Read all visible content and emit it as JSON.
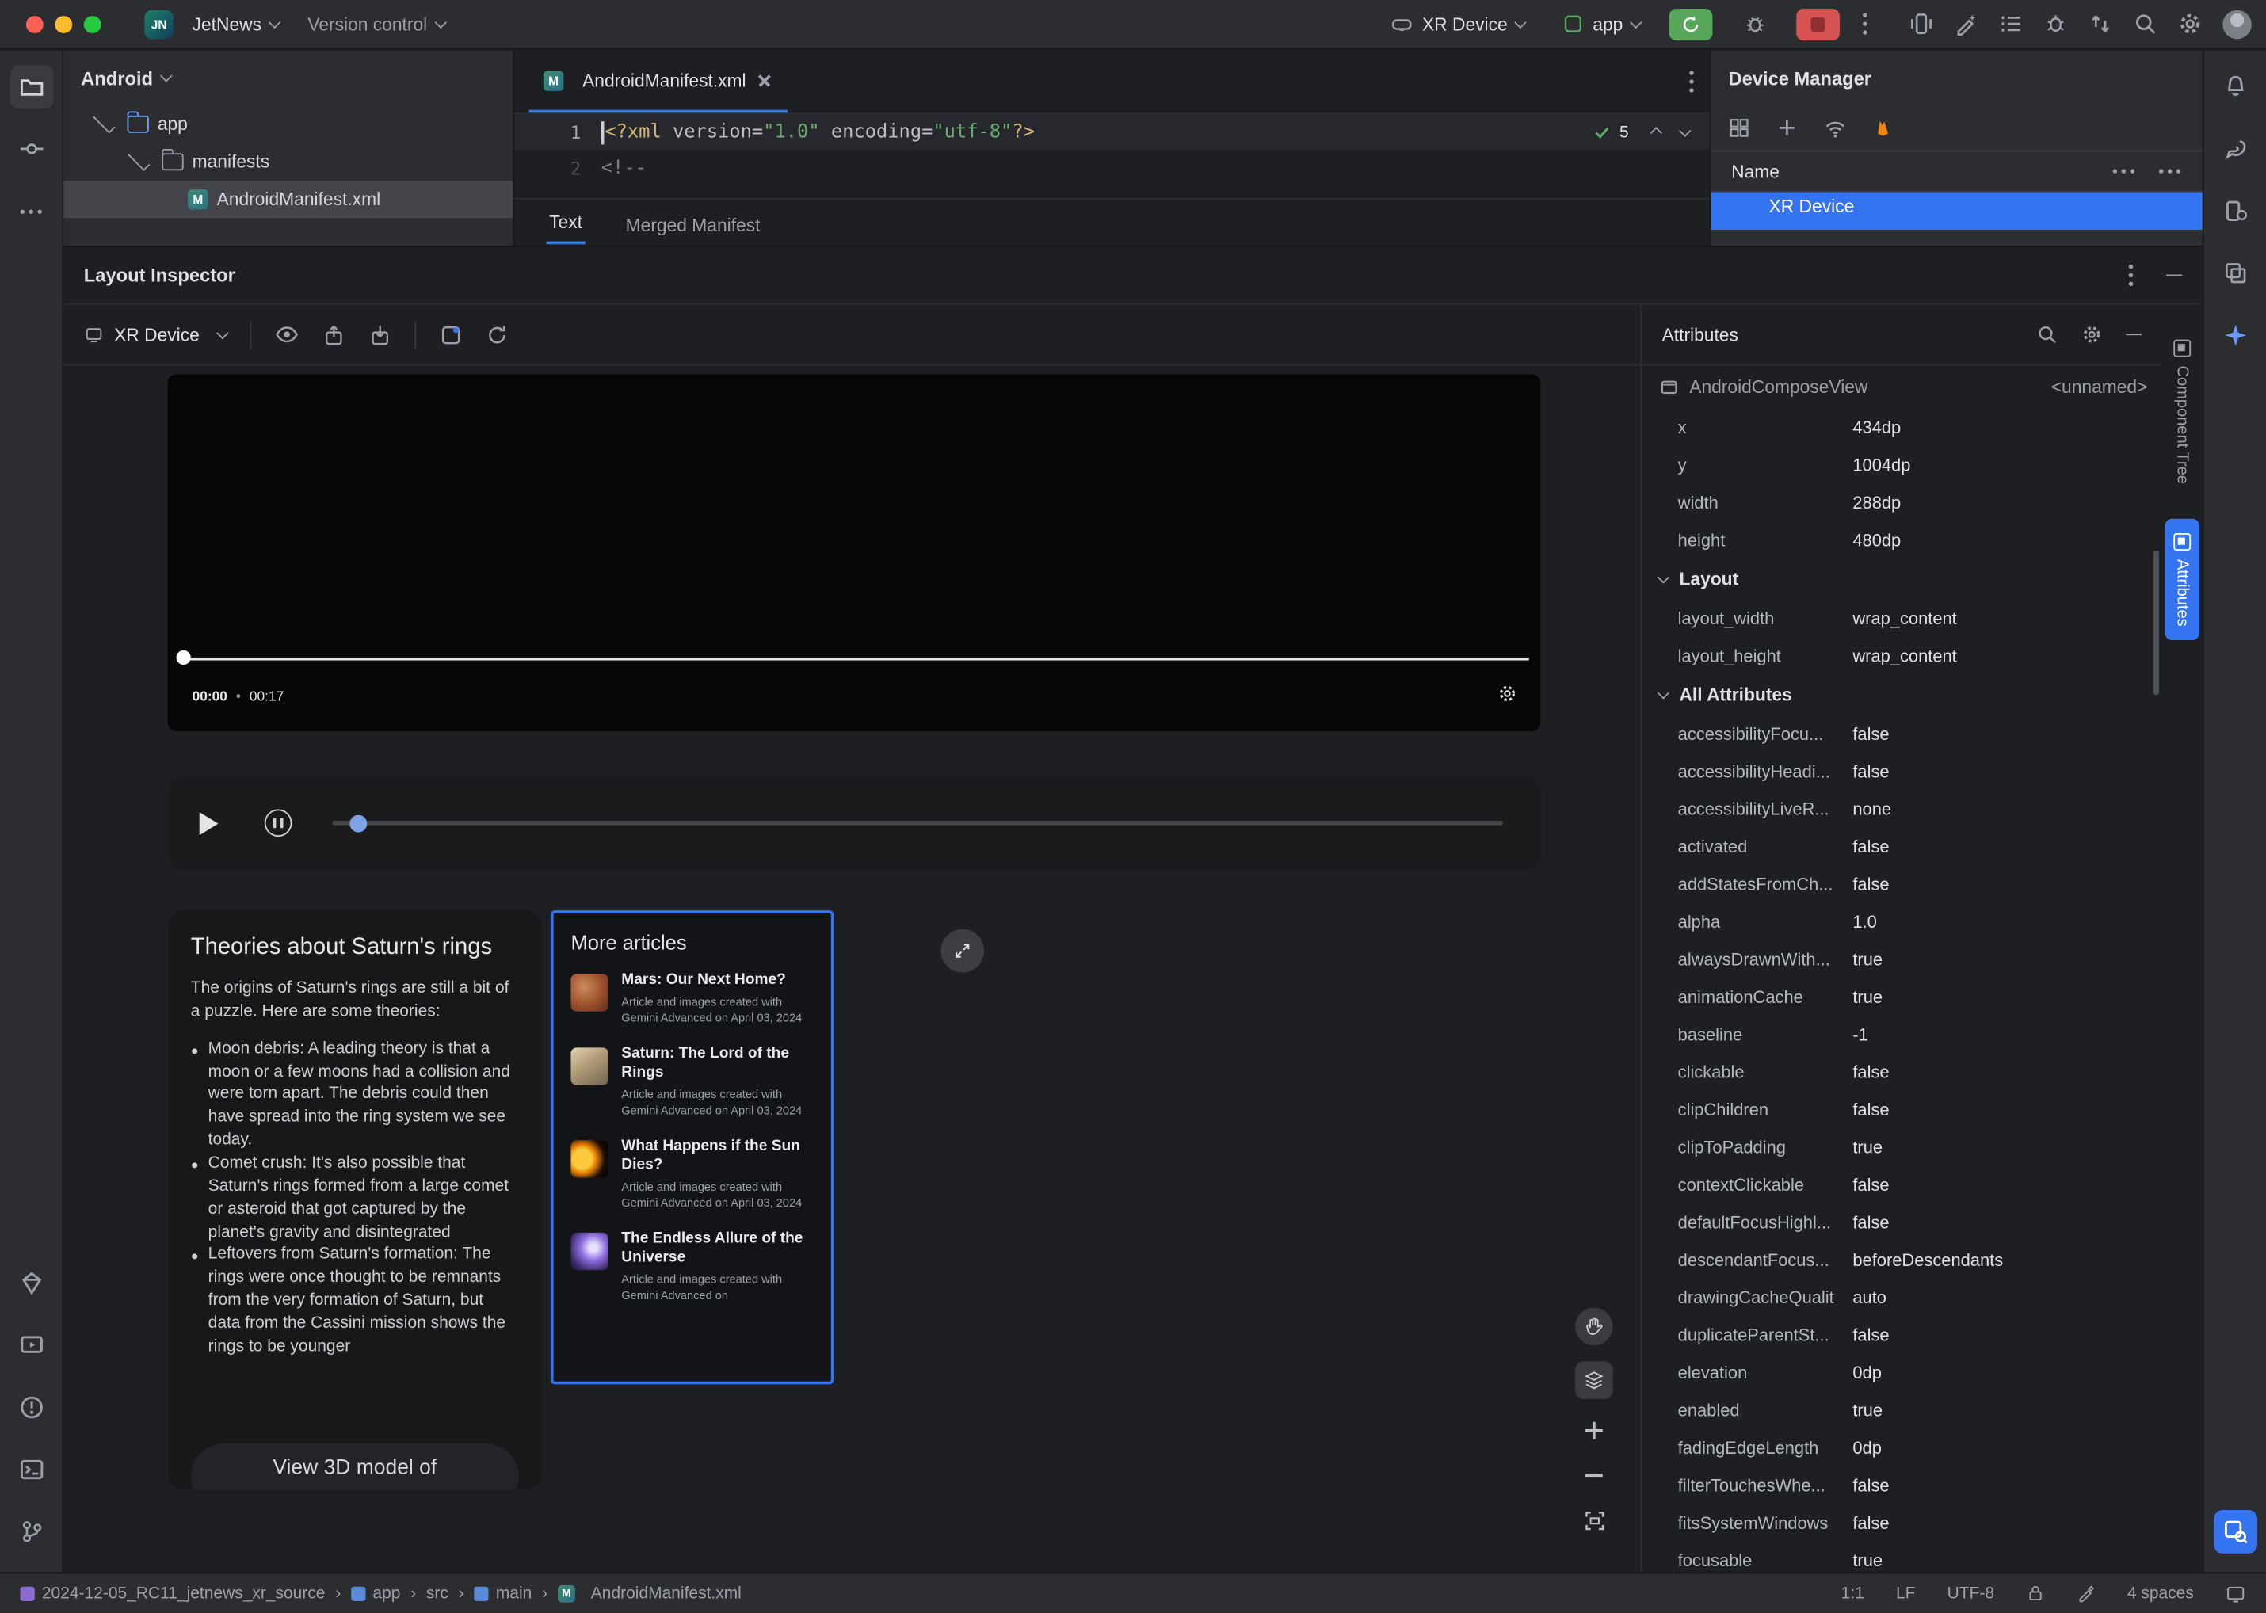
{
  "colors": {
    "accent": "#3574f0",
    "selection_gray": "#43454a",
    "run_green": "#57a65c",
    "stop_red": "#d75252"
  },
  "icons": [
    "close",
    "minimize",
    "zoom",
    "project-folder",
    "commit",
    "more",
    "dependencies",
    "running-devices",
    "problems",
    "terminal",
    "git-branch",
    "bell",
    "gradle",
    "device-manager",
    "build-variants",
    "gemini-sparkle",
    "layout-inspector",
    "device-mirror",
    "ai-edit",
    "checklist",
    "profiler",
    "vcs-update",
    "search",
    "settings",
    "avatar",
    "eye",
    "copy-up",
    "paste-down",
    "export",
    "refresh",
    "pan-hand",
    "layers",
    "zoom-in",
    "zoom-out",
    "fit-screen",
    "gear",
    "play",
    "pause",
    "wifi",
    "firebase",
    "add",
    "grid",
    "lock",
    "indent-marker",
    "screen"
  ],
  "titlebar": {
    "logo_text": "JN",
    "project_name": "JetNews",
    "vcs_widget": "Version control",
    "device_selector": "XR Device",
    "run_config": "app"
  },
  "project_panel": {
    "view_selector": "Android",
    "tree": {
      "app": "app",
      "manifests": "manifests",
      "manifest_file": "AndroidManifest.xml"
    }
  },
  "editor": {
    "tab_title": "AndroidManifest.xml",
    "inspections": "5",
    "gutter": [
      "1",
      "2"
    ],
    "line1": {
      "pi_open": "<?xml",
      "attr1": " version=",
      "val1": "\"1.0\"",
      "attr2": " encoding=",
      "val2": "\"utf-8\"",
      "pi_close": "?>"
    },
    "line2": "<!--",
    "view_tabs": [
      "Text",
      "Merged Manifest"
    ]
  },
  "device_manager": {
    "title": "Device Manager",
    "name_column": "Name",
    "selected_device": "XR Device"
  },
  "layout_inspector": {
    "title": "Layout Inspector",
    "process": "XR Device",
    "video": {
      "elapsed": "00:00",
      "duration": "00:17",
      "time_separator": "•"
    },
    "saturn_card": {
      "title": "Theories about Saturn's rings",
      "intro": "The origins of Saturn's rings are still a bit of a puzzle. Here are some theories:",
      "bullets": [
        "Moon debris: A leading theory is that a moon or a few moons had a collision and were torn apart. The debris could then have spread into the ring system we see today.",
        "Comet crush: It's also possible that Saturn's rings formed from a large comet or asteroid that got captured by the planet's gravity and disintegrated",
        "Leftovers from Saturn's formation: The rings were once thought to be remnants from the very formation of Saturn, but data from the Cassini mission shows the rings to be younger"
      ],
      "cta_partial": "View 3D model of"
    },
    "articles_card": {
      "title": "More articles",
      "items": [
        {
          "title": "Mars: Our Next Home?",
          "caption": "Article and images created with Gemini Advanced on April 03, 2024",
          "thumb": "thumb-mars"
        },
        {
          "title": "Saturn: The Lord of the Rings",
          "caption": "Article and images created with Gemini Advanced on April 03, 2024",
          "thumb": "thumb-saturn"
        },
        {
          "title": "What Happens if the Sun Dies?",
          "caption": "Article and images created with Gemini Advanced on April 03, 2024",
          "thumb": "thumb-sun"
        },
        {
          "title": "The Endless Allure of the Universe",
          "caption": "Article and images created with Gemini Advanced on",
          "thumb": "thumb-galaxy"
        }
      ]
    }
  },
  "attributes_panel": {
    "title": "Attributes",
    "component": "AndroidComposeView",
    "component_id": "<unnamed>",
    "basic_props": [
      {
        "name": "x",
        "value": "434dp"
      },
      {
        "name": "y",
        "value": "1004dp"
      },
      {
        "name": "width",
        "value": "288dp"
      },
      {
        "name": "height",
        "value": "480dp"
      }
    ],
    "sections": {
      "layout": "Layout",
      "all": "All Attributes"
    },
    "layout_props": [
      {
        "name": "layout_width",
        "value": "wrap_content"
      },
      {
        "name": "layout_height",
        "value": "wrap_content"
      }
    ],
    "all_props": [
      {
        "name": "accessibilityFocu...",
        "value": "false"
      },
      {
        "name": "accessibilityHeadi...",
        "value": "false"
      },
      {
        "name": "accessibilityLiveR...",
        "value": "none"
      },
      {
        "name": "activated",
        "value": "false"
      },
      {
        "name": "addStatesFromCh...",
        "value": "false"
      },
      {
        "name": "alpha",
        "value": "1.0"
      },
      {
        "name": "alwaysDrawnWith...",
        "value": "true"
      },
      {
        "name": "animationCache",
        "value": "true"
      },
      {
        "name": "baseline",
        "value": "-1"
      },
      {
        "name": "clickable",
        "value": "false"
      },
      {
        "name": "clipChildren",
        "value": "false"
      },
      {
        "name": "clipToPadding",
        "value": "true"
      },
      {
        "name": "contextClickable",
        "value": "false"
      },
      {
        "name": "defaultFocusHighl...",
        "value": "false"
      },
      {
        "name": "descendantFocus...",
        "value": "beforeDescendants"
      },
      {
        "name": "drawingCacheQualit",
        "value": "auto"
      },
      {
        "name": "duplicateParentSt...",
        "value": "false"
      },
      {
        "name": "elevation",
        "value": "0dp"
      },
      {
        "name": "enabled",
        "value": "true"
      },
      {
        "name": "fadingEdgeLength",
        "value": "0dp"
      },
      {
        "name": "filterTouchesWhe...",
        "value": "false"
      },
      {
        "name": "fitsSystemWindows",
        "value": "false"
      },
      {
        "name": "focusable",
        "value": "true"
      }
    ]
  },
  "side_tabs": [
    {
      "label": "Component Tree"
    },
    {
      "label": "Attributes"
    }
  ],
  "statusbar": {
    "separator": "›",
    "breadcrumbs": [
      "2024-12-05_RC11_jetnews_xr_source",
      "app",
      "src",
      "main",
      "AndroidManifest.xml"
    ],
    "caret_position": "1:1",
    "line_ending": "LF",
    "encoding": "UTF-8",
    "indent": "4 spaces"
  }
}
